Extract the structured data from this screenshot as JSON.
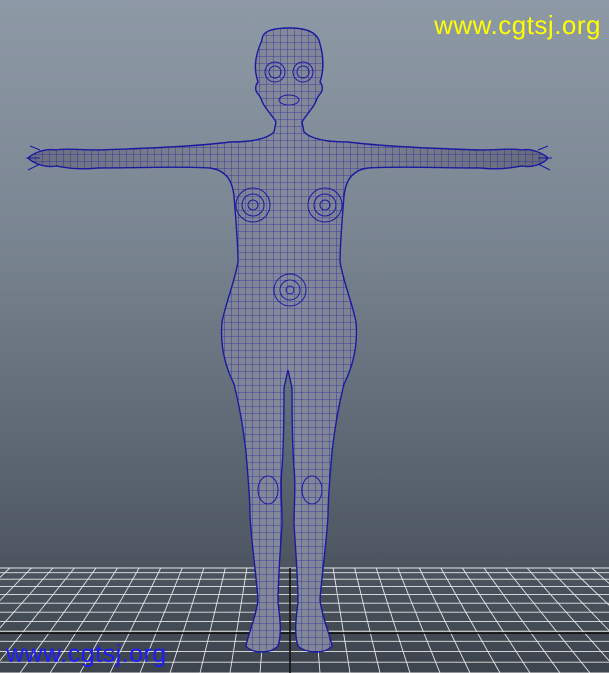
{
  "viewport": {
    "background_top": "#8e99a6",
    "background_bottom": "#3c434c",
    "mesh_fill": "#7b7f8e",
    "wire_color": "#1a1aa0",
    "grid_color": "#e6e6e6",
    "grid_axis_color": "#111111"
  },
  "watermarks": {
    "top_right": {
      "text": "www.cgtsj.org",
      "color": "#ffff00"
    },
    "bottom_left": {
      "text": "www.cgtsj.org",
      "color": "#1c1cff"
    }
  }
}
